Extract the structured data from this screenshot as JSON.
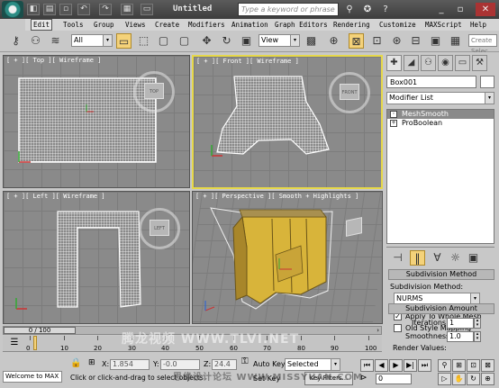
{
  "titlebar": {
    "doc_title": "Untitled",
    "search_placeholder": "Type a keyword or phrase",
    "quick_icons": [
      "◧",
      "▤",
      "▫",
      "↶",
      "↷",
      "▦",
      "▭"
    ],
    "right_buttons": [
      "⚲",
      "✪",
      "?",
      "_",
      "▫",
      "✕"
    ]
  },
  "menubar": {
    "items": [
      "Edit",
      "Tools",
      "Group",
      "Views",
      "Create",
      "Modifiers",
      "Animation",
      "Graph Editors",
      "Rendering",
      "Customize",
      "MAXScript",
      "Help"
    ]
  },
  "toolbar": {
    "icons": [
      "⚷",
      "⚇",
      "≋",
      "▾",
      "▭",
      "⬚",
      "▢",
      "✥",
      "↻",
      "▣",
      "▩",
      "⊕",
      "⊠",
      "⊡",
      "⊛",
      "⊟",
      "▣",
      "▦",
      "⚑",
      "▣"
    ],
    "filter_value": "All",
    "coord_value": "View",
    "create_selection": "Create Selec"
  },
  "viewports": {
    "top_label": "[ + ][ Top ][ Wireframe ]",
    "front_label": "[ + ][ Front ][ Wireframe ]",
    "left_label": "[ + ][ Left ][ Wireframe ]",
    "persp_label": "[ + ][ Perspective ][ Smooth + Highlights ]",
    "viewcube_top": "TOP",
    "viewcube_front": "FRONT",
    "viewcube_left": "LEFT",
    "persp_axis": "x"
  },
  "cmdpanel": {
    "object_name": "Box001",
    "modifier_list": "Modifier List",
    "stack": [
      {
        "label": "MeshSmooth",
        "selected": true
      },
      {
        "label": "ProBoolean",
        "selected": false
      }
    ],
    "subdivision_method_title": "Subdivision Method",
    "subdivision_method_label": "Subdivision Method:",
    "subdivision_method_value": "NURMS",
    "apply_whole_mesh": "Apply To Whole Mesh",
    "old_style_mapping": "Old Style Mapping",
    "subdivision_amount_title": "Subdivision Amount",
    "iterations_label": "Iterations:",
    "iterations_value": "1",
    "smoothness_label": "Smoothness:",
    "smoothness_value": "1.0",
    "render_values_label": "Render Values:"
  },
  "timeline": {
    "slider_text": "0 / 100",
    "ticks": [
      "0",
      "10",
      "20",
      "30",
      "40",
      "50",
      "60",
      "70",
      "80",
      "90",
      "100"
    ]
  },
  "status": {
    "welcome": "Welcome to MAX",
    "prompt": "Click or click-and-drag to select objects",
    "x_label": "X:",
    "x_value": "1.854",
    "y_label": "Y:",
    "y_value": "-0.0",
    "z_label": "Z:",
    "z_value": "24.4",
    "auto_key": "Auto Key",
    "selected": "Selected",
    "set_key": "Set Key",
    "key_filters": "Key Filters...",
    "frame": "0"
  },
  "watermarks": {
    "center": "腾龙视频 WWW.TLVI.NET",
    "bottom": "思缘设计论坛 WWW.MISSYUAN.COM"
  },
  "colors": {
    "active_border": "#e6d84a",
    "object_yellow": "#d8b43a",
    "wire_white": "#ffffff"
  }
}
